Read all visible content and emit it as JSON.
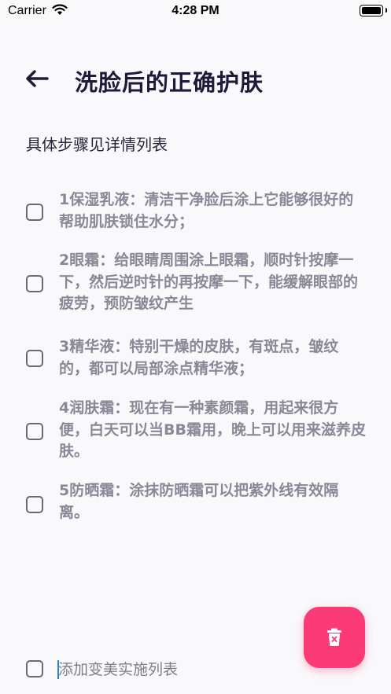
{
  "status": {
    "carrier": "Carrier",
    "time": "4:28 PM"
  },
  "header": {
    "title": "洗脸后的正确护肤"
  },
  "subtitle": "具体步骤见详情列表",
  "todos": [
    {
      "text": "1保湿乳液：清洁干净脸后涂上它能够很好的帮助肌肤锁住水分；",
      "checked": false
    },
    {
      "text": "2眼霜：给眼睛周围涂上眼霜，顺时针按摩一下，然后逆时针的再按摩一下，能缓解眼部的疲劳，预防皱纹产生",
      "checked": false
    },
    {
      "text": "3精华液：特别干燥的皮肤，有斑点，皱纹的，都可以局部涂点精华液；",
      "checked": false
    },
    {
      "text": "4润肤霜：现在有一种素颜霜，用起来很方便，白天可以当BB霜用，晚上可以用来滋养皮肤。",
      "checked": false
    },
    {
      "text": "5防晒霜：涂抹防晒霜可以把紫外线有效隔离。",
      "checked": false
    }
  ],
  "add": {
    "placeholder": "添加变美实施列表"
  },
  "colors": {
    "accent": "#fb3b78",
    "title": "#1d1a3a",
    "item_text": "#8a8896"
  }
}
